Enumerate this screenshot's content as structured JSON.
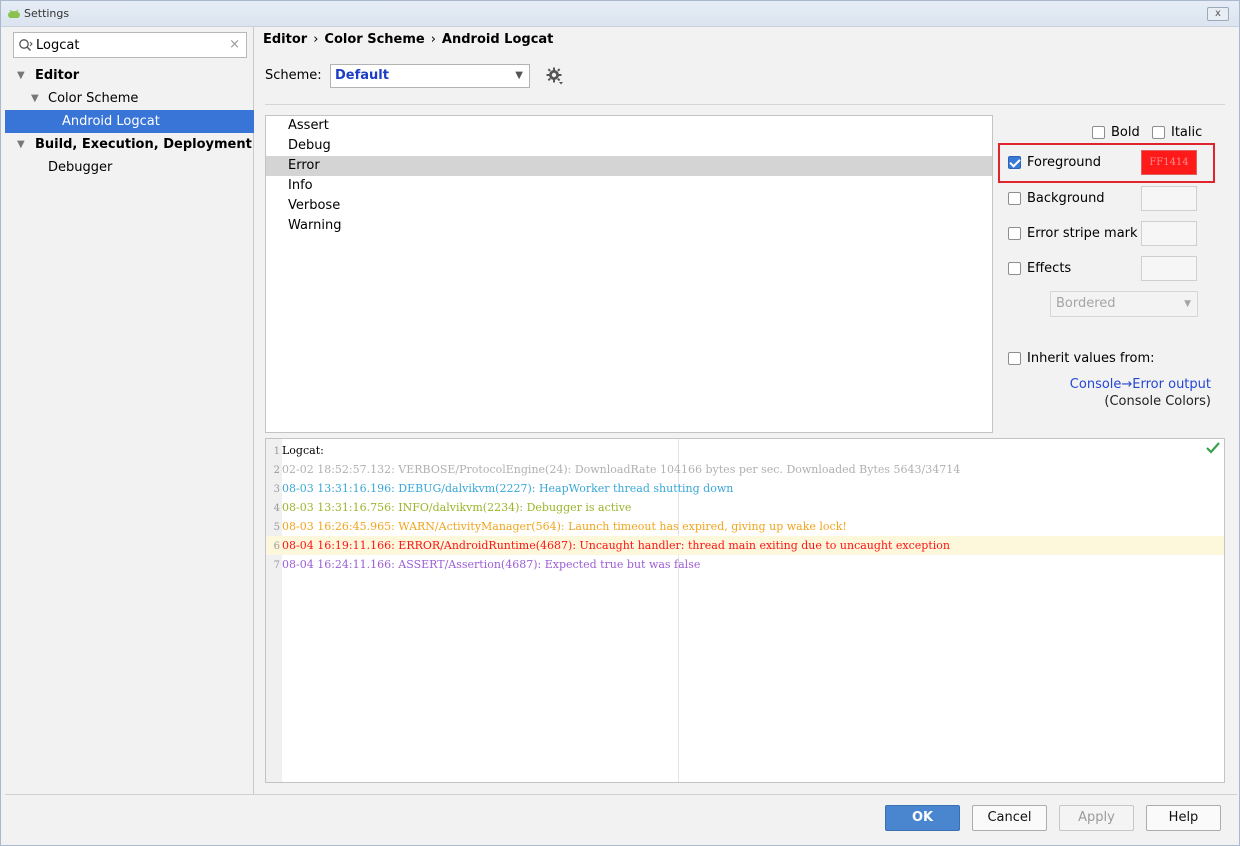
{
  "window": {
    "title": "Settings",
    "close_label": "x"
  },
  "search": {
    "value": "Logcat",
    "clear_label": "×"
  },
  "tree": {
    "editor": "Editor",
    "color_scheme": "Color Scheme",
    "android_logcat": "Android Logcat",
    "build": "Build, Execution, Deployment",
    "debugger": "Debugger",
    "expanded_arrow": "▼"
  },
  "breadcrumb": {
    "part1": "Editor",
    "part2": "Color Scheme",
    "part3": "Android Logcat",
    "separator": "›"
  },
  "scheme": {
    "label": "Scheme:",
    "value": "Default",
    "chevron": "▼"
  },
  "attributes": [
    "Assert",
    "Debug",
    "Error",
    "Info",
    "Verbose",
    "Warning"
  ],
  "selected_attribute": "Error",
  "options": {
    "bold": "Bold",
    "italic": "Italic",
    "foreground": "Foreground",
    "foreground_checked": true,
    "foreground_color": "FF1414",
    "background": "Background",
    "error_stripe": "Error stripe mark",
    "effects": "Effects",
    "effects_type": "Bordered",
    "effects_chevron": "▼",
    "inherit": "Inherit values from:",
    "inherit_link": "Console→Error output",
    "inherit_sub": "(Console Colors)"
  },
  "preview": {
    "lines": [
      {
        "n": "1",
        "text": "Logcat:",
        "color": "#000000"
      },
      {
        "n": "2",
        "text": "02-02 18:52:57.132: VERBOSE/ProtocolEngine(24): DownloadRate 104166 bytes per sec. Downloaded Bytes 5643/34714",
        "color": "#b0b0b0"
      },
      {
        "n": "3",
        "text": "08-03 13:31:16.196: DEBUG/dalvikvm(2227): HeapWorker thread shutting down",
        "color": "#3aa7d8"
      },
      {
        "n": "4",
        "text": "08-03 13:31:16.756: INFO/dalvikvm(2234): Debugger is active",
        "color": "#9bb52a"
      },
      {
        "n": "5",
        "text": "08-03 16:26:45.965: WARN/ActivityManager(564): Launch timeout has expired, giving up wake lock!",
        "color": "#f0a41c"
      },
      {
        "n": "6",
        "text": "08-04 16:19:11.166: ERROR/AndroidRuntime(4687): Uncaught handler: thread main exiting due to uncaught exception",
        "color": "#ff1414"
      },
      {
        "n": "7",
        "text": "08-04 16:24:11.166: ASSERT/Assertion(4687): Expected true but was false",
        "color": "#9b5ed6"
      }
    ]
  },
  "buttons": {
    "ok": "OK",
    "cancel": "Cancel",
    "apply": "Apply",
    "help": "Help"
  }
}
